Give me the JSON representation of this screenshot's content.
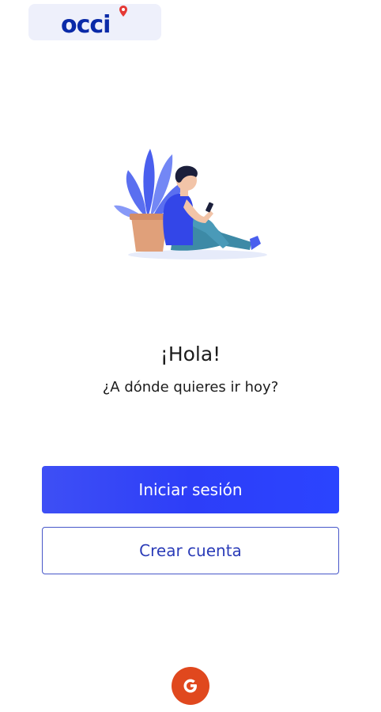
{
  "brand": {
    "logo_text": "occi",
    "logo_color": "#0a2aa8",
    "pin_color": "#e53935"
  },
  "welcome": {
    "greeting": "¡Hola!",
    "subtitle": "¿A dónde quieres ir hoy?"
  },
  "actions": {
    "login_label": "Iniciar sesión",
    "signup_label": "Crear cuenta",
    "google_icon": "google-icon"
  },
  "colors": {
    "primary": "#2d3ef8",
    "outline": "#4757c9",
    "google": "#e0481e"
  }
}
